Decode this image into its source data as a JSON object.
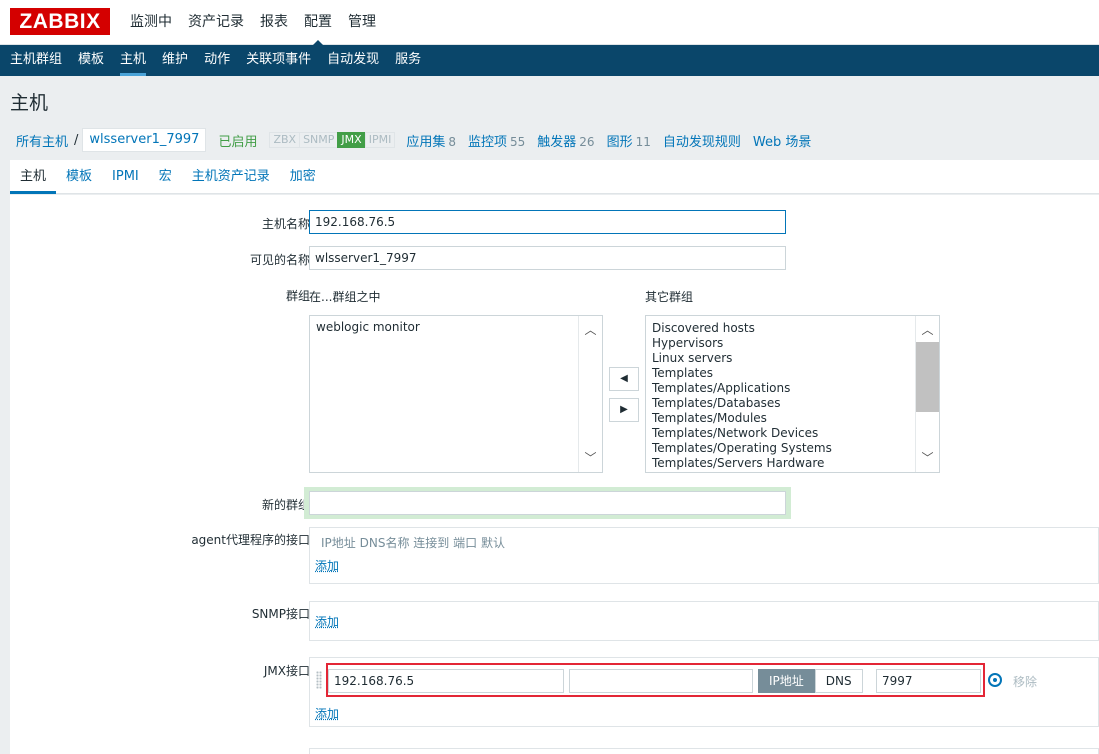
{
  "logo": "ZABBIX",
  "main_menu": [
    {
      "label": "监测中"
    },
    {
      "label": "资产记录"
    },
    {
      "label": "报表"
    },
    {
      "label": "配置"
    },
    {
      "label": "管理"
    }
  ],
  "sub_menu": [
    {
      "label": "主机群组"
    },
    {
      "label": "模板"
    },
    {
      "label": "主机"
    },
    {
      "label": "维护"
    },
    {
      "label": "动作"
    },
    {
      "label": "关联项事件"
    },
    {
      "label": "自动发现"
    },
    {
      "label": "服务"
    }
  ],
  "page_title": "主机",
  "host_nav": {
    "all_hosts": "所有主机",
    "separator": "/",
    "current_host": "wlsserver1_7997",
    "status": "已启用",
    "availability": [
      "ZBX",
      "SNMP",
      "JMX",
      "IPMI"
    ],
    "links": [
      {
        "label": "应用集",
        "count": "8"
      },
      {
        "label": "监控项",
        "count": "55"
      },
      {
        "label": "触发器",
        "count": "26"
      },
      {
        "label": "图形",
        "count": "11"
      },
      {
        "label": "自动发现规则",
        "count": ""
      },
      {
        "label": "Web 场景",
        "count": ""
      }
    ]
  },
  "tabs": [
    "主机",
    "模板",
    "IPMI",
    "宏",
    "主机资产记录",
    "加密"
  ],
  "form": {
    "host_name_label": "主机名称",
    "host_name_value": "192.168.76.5",
    "visible_name_label": "可见的名称",
    "visible_name_value": "wlsserver1_7997",
    "groups_label": "群组",
    "in_groups_label": "在...群组之中",
    "other_groups_label": "其它群组",
    "in_groups": [
      "weblogic monitor"
    ],
    "other_groups": [
      "Discovered hosts",
      "Hypervisors",
      "Linux servers",
      "Templates",
      "Templates/Applications",
      "Templates/Databases",
      "Templates/Modules",
      "Templates/Network Devices",
      "Templates/Operating Systems",
      "Templates/Servers Hardware"
    ],
    "new_group_label": "新的群组",
    "new_group_value": "",
    "agent_if_label": "agent代理程序的接口",
    "if_headers": [
      "IP地址",
      "DNS名称",
      "连接到",
      "端口",
      "默认"
    ],
    "add_label": "添加",
    "snmp_if_label": "SNMP接口",
    "jmx_if_label": "JMX接口",
    "jmx": {
      "ip": "192.168.76.5",
      "dns": "",
      "connect_ip": "IP地址",
      "connect_dns": "DNS",
      "port": "7997",
      "remove": "移除"
    }
  },
  "colors": {
    "logo_red": "#d40000",
    "submenu_bg": "#0a466a",
    "link_blue": "#0275b8",
    "enabled_green": "#429e47",
    "highlight_red": "#e32636"
  }
}
